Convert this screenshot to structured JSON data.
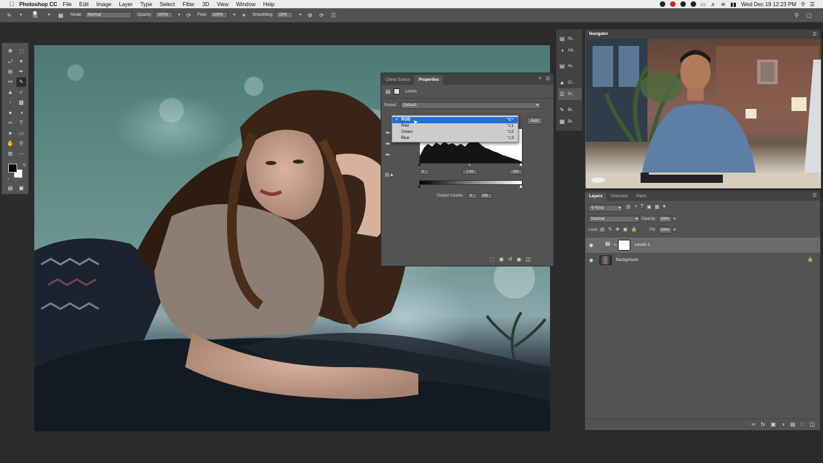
{
  "menubar": {
    "apple": "",
    "app_name": "Photoshop CC",
    "items": [
      "File",
      "Edit",
      "Image",
      "Layer",
      "Type",
      "Select",
      "Filter",
      "3D",
      "View",
      "Window",
      "Help"
    ],
    "datetime": "Wed Dec 19  12:23 PM"
  },
  "options_bar": {
    "brush_size": "765",
    "mode_label": "Mode:",
    "mode_value": "Normal",
    "opacity_label": "Opacity:",
    "opacity_value": "100%",
    "flow_label": "Flow:",
    "flow_value": "100%",
    "smoothing_label": "Smoothing:",
    "smoothing_value": "10%"
  },
  "properties": {
    "tab_clone": "Clone Source",
    "tab_props": "Properties",
    "adjustment_title": "Levels",
    "preset_label": "Preset:",
    "preset_value": "Default",
    "auto_button": "Auto",
    "input_black": "0",
    "input_mid": "1.00",
    "input_white": "255",
    "output_label": "Output Levels:",
    "output_black": "0",
    "output_white": "255"
  },
  "channel_menu": {
    "items": [
      {
        "label": "RGB",
        "shortcut": "⌥~",
        "selected": true
      },
      {
        "label": "Red",
        "shortcut": "⌥1",
        "selected": false
      },
      {
        "label": "Green",
        "shortcut": "⌥2",
        "selected": false
      },
      {
        "label": "Blue",
        "shortcut": "⌥3",
        "selected": false
      }
    ]
  },
  "strip": {
    "items": [
      "Hi..",
      "Ad..",
      "Hi..",
      "Cl..",
      "Pr..",
      "Br..",
      "Br.."
    ]
  },
  "navigator": {
    "title": "Navigator"
  },
  "layers": {
    "tab_layers": "Layers",
    "tab_channels": "Channels",
    "tab_paths": "Paths",
    "filter_kind": "Kind",
    "blend_mode": "Normal",
    "opacity_label": "Opacity:",
    "opacity_value": "100%",
    "lock_label": "Lock:",
    "fill_label": "Fill:",
    "fill_value": "100%",
    "rows": [
      {
        "name": "Levels 1"
      },
      {
        "name": "Background"
      }
    ]
  },
  "colors": {
    "menu_highlight": "#1f6fd8",
    "panel_bg": "#535353",
    "panel_header": "#424242",
    "app_bg": "#2b2b2b"
  }
}
